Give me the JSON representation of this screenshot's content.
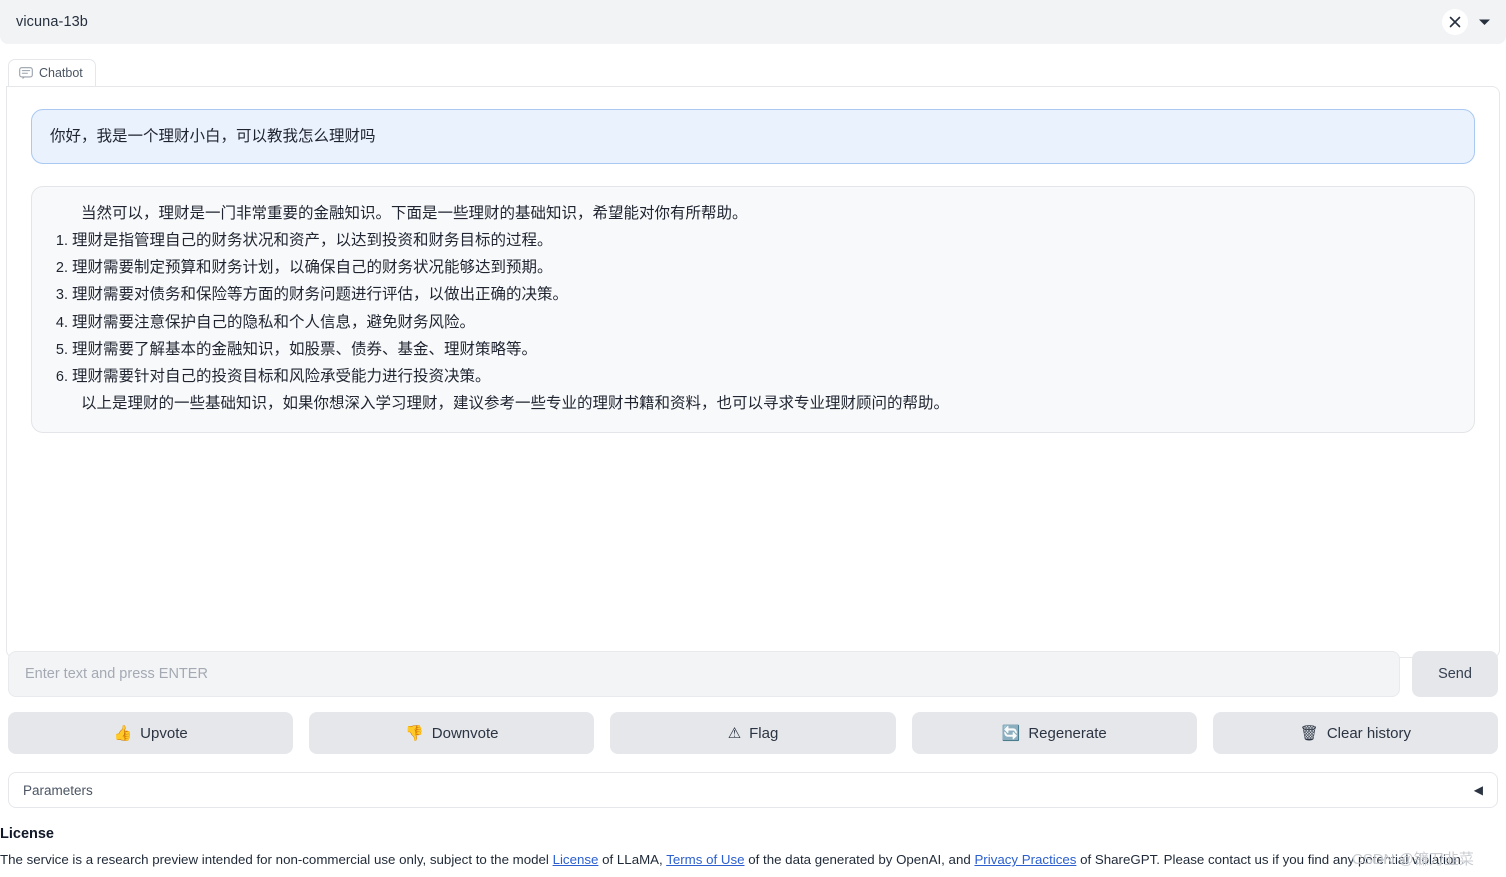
{
  "header": {
    "title": "vicuna-13b",
    "close_icon": "close-icon",
    "chevron_icon": "chevron-down-icon"
  },
  "chat": {
    "tab_label": "Chatbot",
    "tab_icon": "speech-bubble-icon",
    "messages": [
      {
        "role": "user",
        "text": "你好，我是一个理财小白，可以教我怎么理财吗"
      },
      {
        "role": "bot",
        "intro": "当然可以，理财是一门非常重要的金融知识。下面是一些理财的基础知识，希望能对你有所帮助。",
        "items": [
          "理财是指管理自己的财务状况和资产，以达到投资和财务目标的过程。",
          "理财需要制定预算和财务计划，以确保自己的财务状况能够达到预期。",
          "理财需要对债务和保险等方面的财务问题进行评估，以做出正确的决策。",
          "理财需要注意保护自己的隐私和个人信息，避免财务风险。",
          "理财需要了解基本的金融知识，如股票、债券、基金、理财策略等。",
          "理财需要针对自己的投资目标和风险承受能力进行投资决策。"
        ],
        "outro": "以上是理财的一些基础知识，如果你想深入学习理财，建议参考一些专业的理财书籍和资料，也可以寻求专业理财顾问的帮助。"
      }
    ]
  },
  "input": {
    "placeholder": "Enter text and press ENTER",
    "value": "",
    "send_label": "Send"
  },
  "actions": [
    {
      "label": "Upvote",
      "icon": "thumbs-up-icon",
      "glyph": "👍"
    },
    {
      "label": "Downvote",
      "icon": "thumbs-down-icon",
      "glyph": "👎"
    },
    {
      "label": "Flag",
      "icon": "warning-icon",
      "glyph": "⚠"
    },
    {
      "label": "Regenerate",
      "icon": "refresh-icon",
      "glyph": "🔄"
    },
    {
      "label": "Clear history",
      "icon": "trash-icon",
      "glyph": "🗑"
    }
  ],
  "parameters": {
    "label": "Parameters",
    "toggle_icon": "triangle-left-icon",
    "toggle_glyph": "◀"
  },
  "license": {
    "heading": "License",
    "text_1": "The service is a research preview intended for non-commercial use only, subject to the model ",
    "link_1": "License",
    "text_2": " of LLaMA, ",
    "link_2": "Terms of Use",
    "text_3": " of the data generated by OpenAI, and ",
    "link_3": "Privacy Practices",
    "text_4": " of ShareGPT. Please contact us if you find any potential violation."
  },
  "watermark": "CSDN @镰刀韭菜",
  "colors": {
    "header_bg": "#f1f3f5",
    "user_bubble_bg": "#eaf2fd",
    "user_bubble_border": "#a9c8f2",
    "bot_bubble_bg": "#f8f9fa",
    "button_bg": "#e5e7eb",
    "link": "#2b5fd0"
  }
}
